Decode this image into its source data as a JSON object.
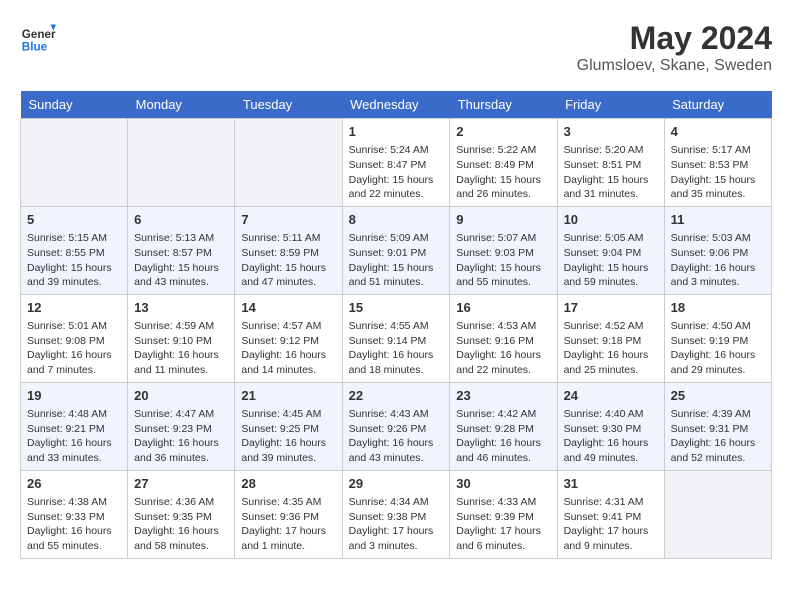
{
  "header": {
    "logo_line1": "General",
    "logo_line2": "Blue",
    "month_year": "May 2024",
    "location": "Glumsloev, Skane, Sweden"
  },
  "days_of_week": [
    "Sunday",
    "Monday",
    "Tuesday",
    "Wednesday",
    "Thursday",
    "Friday",
    "Saturday"
  ],
  "weeks": [
    [
      {
        "day": "",
        "details": ""
      },
      {
        "day": "",
        "details": ""
      },
      {
        "day": "",
        "details": ""
      },
      {
        "day": "1",
        "details": "Sunrise: 5:24 AM\nSunset: 8:47 PM\nDaylight: 15 hours\nand 22 minutes."
      },
      {
        "day": "2",
        "details": "Sunrise: 5:22 AM\nSunset: 8:49 PM\nDaylight: 15 hours\nand 26 minutes."
      },
      {
        "day": "3",
        "details": "Sunrise: 5:20 AM\nSunset: 8:51 PM\nDaylight: 15 hours\nand 31 minutes."
      },
      {
        "day": "4",
        "details": "Sunrise: 5:17 AM\nSunset: 8:53 PM\nDaylight: 15 hours\nand 35 minutes."
      }
    ],
    [
      {
        "day": "5",
        "details": "Sunrise: 5:15 AM\nSunset: 8:55 PM\nDaylight: 15 hours\nand 39 minutes."
      },
      {
        "day": "6",
        "details": "Sunrise: 5:13 AM\nSunset: 8:57 PM\nDaylight: 15 hours\nand 43 minutes."
      },
      {
        "day": "7",
        "details": "Sunrise: 5:11 AM\nSunset: 8:59 PM\nDaylight: 15 hours\nand 47 minutes."
      },
      {
        "day": "8",
        "details": "Sunrise: 5:09 AM\nSunset: 9:01 PM\nDaylight: 15 hours\nand 51 minutes."
      },
      {
        "day": "9",
        "details": "Sunrise: 5:07 AM\nSunset: 9:03 PM\nDaylight: 15 hours\nand 55 minutes."
      },
      {
        "day": "10",
        "details": "Sunrise: 5:05 AM\nSunset: 9:04 PM\nDaylight: 15 hours\nand 59 minutes."
      },
      {
        "day": "11",
        "details": "Sunrise: 5:03 AM\nSunset: 9:06 PM\nDaylight: 16 hours\nand 3 minutes."
      }
    ],
    [
      {
        "day": "12",
        "details": "Sunrise: 5:01 AM\nSunset: 9:08 PM\nDaylight: 16 hours\nand 7 minutes."
      },
      {
        "day": "13",
        "details": "Sunrise: 4:59 AM\nSunset: 9:10 PM\nDaylight: 16 hours\nand 11 minutes."
      },
      {
        "day": "14",
        "details": "Sunrise: 4:57 AM\nSunset: 9:12 PM\nDaylight: 16 hours\nand 14 minutes."
      },
      {
        "day": "15",
        "details": "Sunrise: 4:55 AM\nSunset: 9:14 PM\nDaylight: 16 hours\nand 18 minutes."
      },
      {
        "day": "16",
        "details": "Sunrise: 4:53 AM\nSunset: 9:16 PM\nDaylight: 16 hours\nand 22 minutes."
      },
      {
        "day": "17",
        "details": "Sunrise: 4:52 AM\nSunset: 9:18 PM\nDaylight: 16 hours\nand 25 minutes."
      },
      {
        "day": "18",
        "details": "Sunrise: 4:50 AM\nSunset: 9:19 PM\nDaylight: 16 hours\nand 29 minutes."
      }
    ],
    [
      {
        "day": "19",
        "details": "Sunrise: 4:48 AM\nSunset: 9:21 PM\nDaylight: 16 hours\nand 33 minutes."
      },
      {
        "day": "20",
        "details": "Sunrise: 4:47 AM\nSunset: 9:23 PM\nDaylight: 16 hours\nand 36 minutes."
      },
      {
        "day": "21",
        "details": "Sunrise: 4:45 AM\nSunset: 9:25 PM\nDaylight: 16 hours\nand 39 minutes."
      },
      {
        "day": "22",
        "details": "Sunrise: 4:43 AM\nSunset: 9:26 PM\nDaylight: 16 hours\nand 43 minutes."
      },
      {
        "day": "23",
        "details": "Sunrise: 4:42 AM\nSunset: 9:28 PM\nDaylight: 16 hours\nand 46 minutes."
      },
      {
        "day": "24",
        "details": "Sunrise: 4:40 AM\nSunset: 9:30 PM\nDaylight: 16 hours\nand 49 minutes."
      },
      {
        "day": "25",
        "details": "Sunrise: 4:39 AM\nSunset: 9:31 PM\nDaylight: 16 hours\nand 52 minutes."
      }
    ],
    [
      {
        "day": "26",
        "details": "Sunrise: 4:38 AM\nSunset: 9:33 PM\nDaylight: 16 hours\nand 55 minutes."
      },
      {
        "day": "27",
        "details": "Sunrise: 4:36 AM\nSunset: 9:35 PM\nDaylight: 16 hours\nand 58 minutes."
      },
      {
        "day": "28",
        "details": "Sunrise: 4:35 AM\nSunset: 9:36 PM\nDaylight: 17 hours\nand 1 minute."
      },
      {
        "day": "29",
        "details": "Sunrise: 4:34 AM\nSunset: 9:38 PM\nDaylight: 17 hours\nand 3 minutes."
      },
      {
        "day": "30",
        "details": "Sunrise: 4:33 AM\nSunset: 9:39 PM\nDaylight: 17 hours\nand 6 minutes."
      },
      {
        "day": "31",
        "details": "Sunrise: 4:31 AM\nSunset: 9:41 PM\nDaylight: 17 hours\nand 9 minutes."
      },
      {
        "day": "",
        "details": ""
      }
    ]
  ]
}
